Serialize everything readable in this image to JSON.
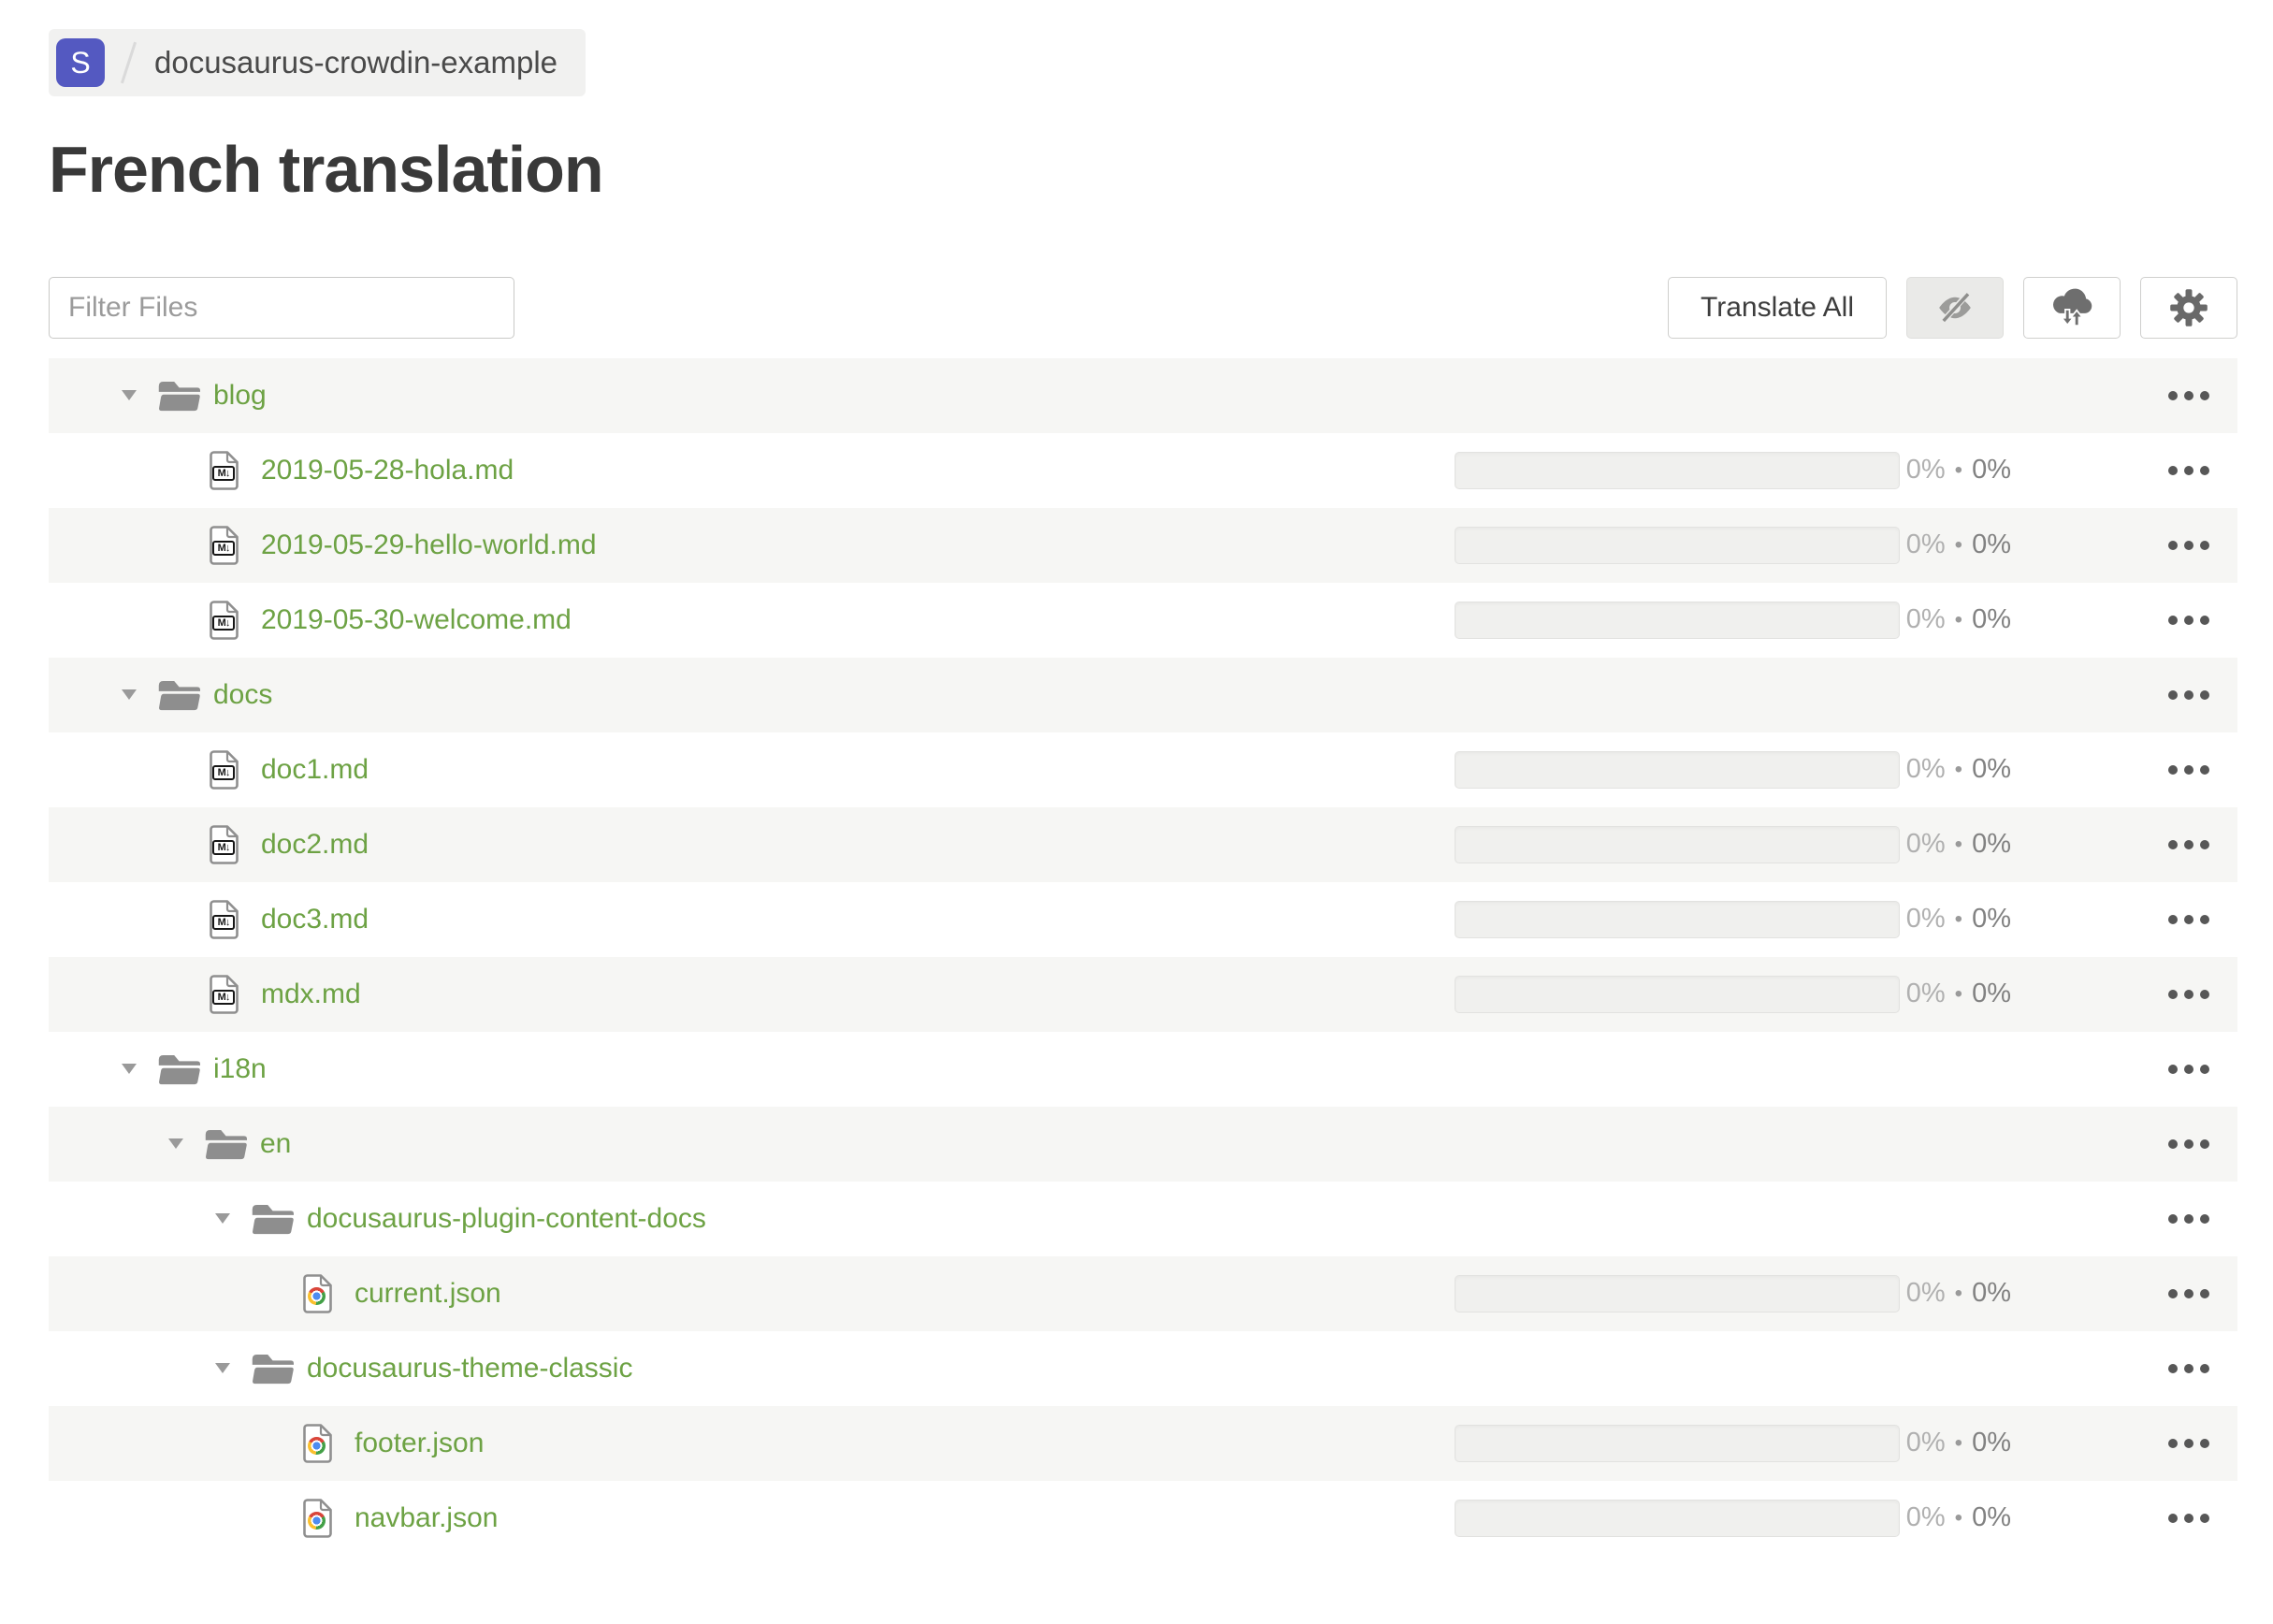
{
  "breadcrumb": {
    "project_initial": "S",
    "project_name": "docusaurus-crowdin-example"
  },
  "page": {
    "title": "French translation"
  },
  "toolbar": {
    "filter_placeholder": "Filter Files",
    "translate_all_label": "Translate All",
    "icon_buttons": [
      "eye-off-icon",
      "cloud-sync-icon",
      "gear-icon"
    ]
  },
  "icons": {
    "markdown_badge": "M↓"
  },
  "tree": {
    "progress_separator": "•",
    "rows": [
      {
        "type": "folder",
        "depth": 0,
        "name": "blog"
      },
      {
        "type": "file",
        "file_kind": "md",
        "depth": 1,
        "name": "2019-05-28-hola.md",
        "progress": {
          "translated": "0%",
          "approved": "0%"
        }
      },
      {
        "type": "file",
        "file_kind": "md",
        "depth": 1,
        "name": "2019-05-29-hello-world.md",
        "progress": {
          "translated": "0%",
          "approved": "0%"
        }
      },
      {
        "type": "file",
        "file_kind": "md",
        "depth": 1,
        "name": "2019-05-30-welcome.md",
        "progress": {
          "translated": "0%",
          "approved": "0%"
        }
      },
      {
        "type": "folder",
        "depth": 0,
        "name": "docs"
      },
      {
        "type": "file",
        "file_kind": "md",
        "depth": 1,
        "name": "doc1.md",
        "progress": {
          "translated": "0%",
          "approved": "0%"
        }
      },
      {
        "type": "file",
        "file_kind": "md",
        "depth": 1,
        "name": "doc2.md",
        "progress": {
          "translated": "0%",
          "approved": "0%"
        }
      },
      {
        "type": "file",
        "file_kind": "md",
        "depth": 1,
        "name": "doc3.md",
        "progress": {
          "translated": "0%",
          "approved": "0%"
        }
      },
      {
        "type": "file",
        "file_kind": "md",
        "depth": 1,
        "name": "mdx.md",
        "progress": {
          "translated": "0%",
          "approved": "0%"
        }
      },
      {
        "type": "folder",
        "depth": 0,
        "name": "i18n"
      },
      {
        "type": "folder",
        "depth": 1,
        "name": "en"
      },
      {
        "type": "folder",
        "depth": 2,
        "name": "docusaurus-plugin-content-docs"
      },
      {
        "type": "file",
        "file_kind": "json",
        "depth": 3,
        "name": "current.json",
        "progress": {
          "translated": "0%",
          "approved": "0%"
        }
      },
      {
        "type": "folder",
        "depth": 2,
        "name": "docusaurus-theme-classic"
      },
      {
        "type": "file",
        "file_kind": "json",
        "depth": 3,
        "name": "footer.json",
        "progress": {
          "translated": "0%",
          "approved": "0%"
        }
      },
      {
        "type": "file",
        "file_kind": "json",
        "depth": 3,
        "name": "navbar.json",
        "progress": {
          "translated": "0%",
          "approved": "0%"
        }
      }
    ]
  },
  "colors": {
    "accent_green": "#6da244",
    "badge_indigo": "#5459c1",
    "row_alt_background": "#f6f6f4",
    "icon_gray": "#8e8e8e"
  }
}
